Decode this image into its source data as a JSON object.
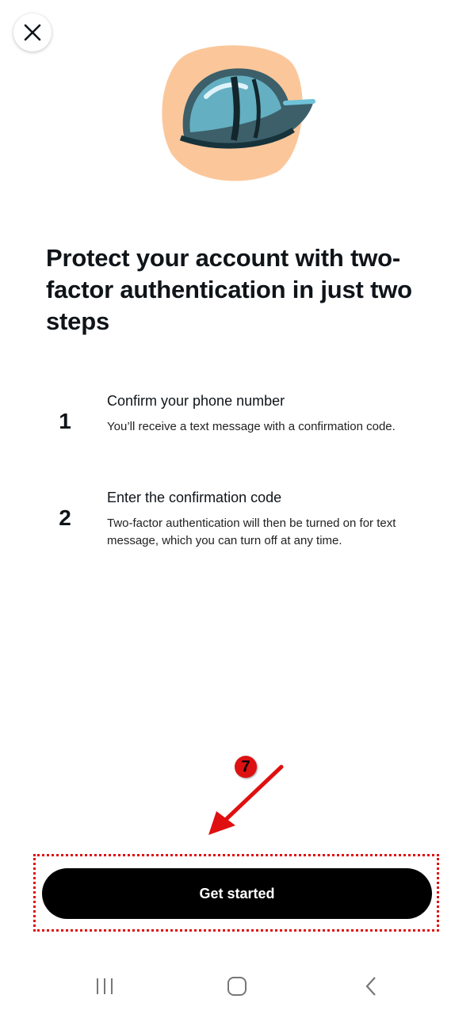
{
  "header": {
    "close_icon": "close-icon"
  },
  "hero": {
    "image": "hard-hat-illustration",
    "colors": {
      "blob": "#f9c89a",
      "helmet": "#4fb3cf"
    }
  },
  "headline": "Protect your account with two-factor authentication in just two steps",
  "steps": [
    {
      "number": "1",
      "title": "Confirm your phone number",
      "description": "You’ll receive a text message with a confirmation code."
    },
    {
      "number": "2",
      "title": "Enter the confirmation code",
      "description": "Two-factor authentication will then be turned on for text message, which you can turn off at any time."
    }
  ],
  "annotation": {
    "marker": "7",
    "color": "#e01010"
  },
  "cta": {
    "label": "Get started"
  },
  "navbar": {
    "recents_icon": "recents-icon",
    "home_icon": "home-icon",
    "back_icon": "back-icon"
  }
}
